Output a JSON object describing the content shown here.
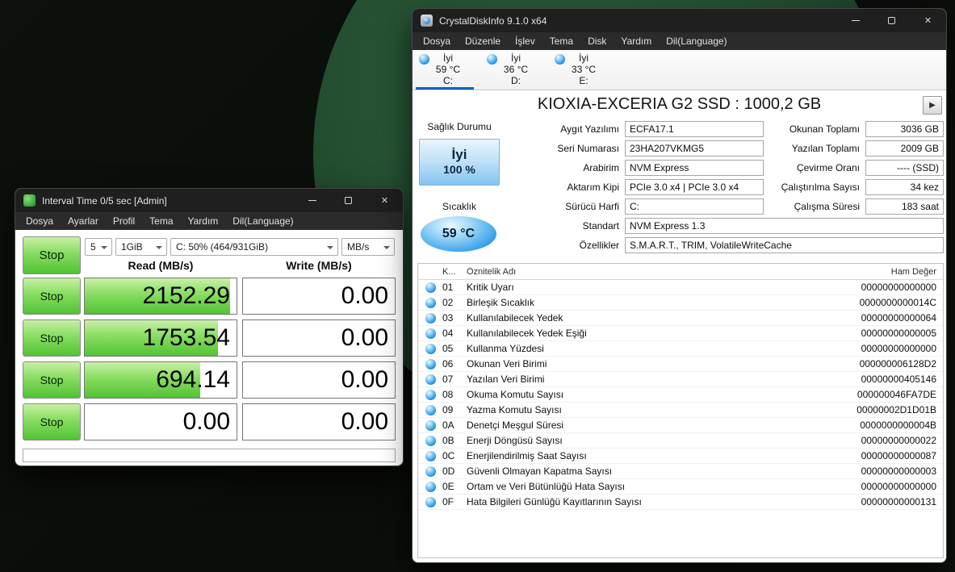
{
  "colors": {
    "accent_blue": "#0a63c2",
    "gauge_green": "#52c234",
    "health_box_blue": "#84c3f0",
    "titlebar_dark": "#1f1f1f"
  },
  "icons": {
    "close": "✕",
    "play": "▶"
  },
  "diskmark": {
    "titlebar": {
      "title": "Interval Time 0/5 sec [Admin]"
    },
    "menu": [
      "Dosya",
      "Ayarlar",
      "Profil",
      "Tema",
      "Yardım",
      "Dil(Language)"
    ],
    "stop_all_label": "Stop",
    "settings": {
      "count": "5",
      "size": "1GiB",
      "target": "C: 50% (464/931GiB)",
      "unit": "MB/s"
    },
    "read_header": "Read (MB/s)",
    "write_header": "Write (MB/s)",
    "rows": [
      {
        "button": "Stop",
        "read": "2152.29",
        "read_fill": 96,
        "write": "0.00",
        "write_fill": 0
      },
      {
        "button": "Stop",
        "read": "1753.54",
        "read_fill": 88,
        "write": "0.00",
        "write_fill": 0
      },
      {
        "button": "Stop",
        "read": "694.14",
        "read_fill": 76,
        "write": "0.00",
        "write_fill": 0
      },
      {
        "button": "Stop",
        "read": "0.00",
        "read_fill": 0,
        "write": "0.00",
        "write_fill": 0
      }
    ]
  },
  "diskinfo": {
    "titlebar": {
      "title": "CrystalDiskInfo 9.1.0 x64"
    },
    "menu": [
      "Dosya",
      "Düzenle",
      "İşlev",
      "Tema",
      "Disk",
      "Yardım",
      "Dil(Language)"
    ],
    "drive_tabs": [
      {
        "status": "İyi",
        "temp": "59 °C",
        "letter": "C:"
      },
      {
        "status": "İyi",
        "temp": "36 °C",
        "letter": "D:"
      },
      {
        "status": "İyi",
        "temp": "33 °C",
        "letter": "E:"
      }
    ],
    "model_title": "KIOXIA-EXCERIA G2 SSD : 1000,2 GB",
    "health": {
      "label": "Sağlık Durumu",
      "status": "İyi",
      "percent": "100 %"
    },
    "temperature": {
      "label": "Sıcaklık",
      "value": "59 °C"
    },
    "fields_mid": [
      {
        "label": "Aygıt Yazılımı",
        "value": "ECFA17.1"
      },
      {
        "label": "Seri Numarası",
        "value": "23HA207VKMG5"
      },
      {
        "label": "Arabirim",
        "value": "NVM Express"
      },
      {
        "label": "Aktarım Kipi",
        "value": "PCIe 3.0 x4 | PCIe 3.0 x4"
      },
      {
        "label": "Sürücü Harfi",
        "value": "C:"
      }
    ],
    "fields_right": [
      {
        "label": "Okunan Toplamı",
        "value": "3036 GB"
      },
      {
        "label": "Yazılan Toplamı",
        "value": "2009 GB"
      },
      {
        "label": "Çevirme Oranı",
        "value": "---- (SSD)"
      },
      {
        "label": "Çalıştırılma Sayısı",
        "value": "34 kez"
      },
      {
        "label": "Çalışma Süresi",
        "value": "183 saat"
      }
    ],
    "fields_wide": [
      {
        "label": "Standart",
        "value": "NVM Express 1.3"
      },
      {
        "label": "Özellikler",
        "value": "S.M.A.R.T., TRIM, VolatileWriteCache"
      }
    ],
    "smart": {
      "col_id": "K...",
      "col_name": "Öznitelik Adı",
      "col_raw": "Ham Değer",
      "rows": [
        {
          "id": "01",
          "name": "Kritik Uyarı",
          "raw": "00000000000000"
        },
        {
          "id": "02",
          "name": "Birleşik Sıcaklık",
          "raw": "0000000000014C"
        },
        {
          "id": "03",
          "name": "Kullanılabilecek Yedek",
          "raw": "00000000000064"
        },
        {
          "id": "04",
          "name": "Kullanılabilecek Yedek Eşiği",
          "raw": "00000000000005"
        },
        {
          "id": "05",
          "name": "Kullanma Yüzdesi",
          "raw": "00000000000000"
        },
        {
          "id": "06",
          "name": "Okunan Veri Birimi",
          "raw": "000000006128D2"
        },
        {
          "id": "07",
          "name": "Yazılan Veri Birimi",
          "raw": "00000000405146"
        },
        {
          "id": "08",
          "name": "Okuma Komutu Sayısı",
          "raw": "000000046FA7DE"
        },
        {
          "id": "09",
          "name": "Yazma Komutu Sayısı",
          "raw": "00000002D1D01B"
        },
        {
          "id": "0A",
          "name": "Denetçi Meşgul Süresi",
          "raw": "0000000000004B"
        },
        {
          "id": "0B",
          "name": "Enerji Döngüsü Sayısı",
          "raw": "00000000000022"
        },
        {
          "id": "0C",
          "name": "Enerjilendirilmiş Saat Sayısı",
          "raw": "00000000000087"
        },
        {
          "id": "0D",
          "name": "Güvenli Olmayan Kapatma Sayısı",
          "raw": "00000000000003"
        },
        {
          "id": "0E",
          "name": "Ortam ve Veri Bütünlüğü Hata Sayısı",
          "raw": "00000000000000"
        },
        {
          "id": "0F",
          "name": "Hata Bilgileri Günlüğü Kayıtlarının Sayısı",
          "raw": "00000000000131"
        }
      ]
    }
  }
}
